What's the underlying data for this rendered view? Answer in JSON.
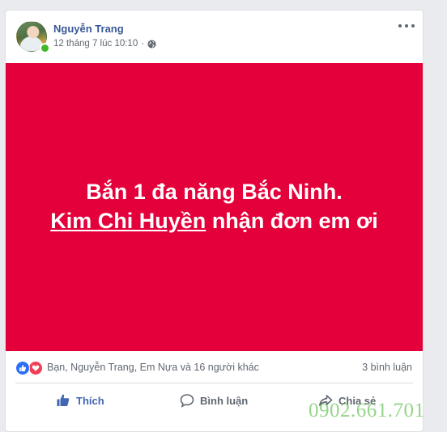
{
  "post": {
    "author": "Nguyễn Trang",
    "timestamp": "12 tháng 7 lúc 10:10",
    "separator": "·",
    "privacy_icon": "globe-icon",
    "text_line1": "Bắn 1 đa năng Bắc Ninh.",
    "mention": "Kim Chi Huyền",
    "text_line2_rest": " nhận đơn em ơi",
    "background_color": "#e4003a"
  },
  "reactions": {
    "icons": [
      "like-icon",
      "love-icon"
    ],
    "summary": "Bạn, Nguyễn Trang, Em Nựa và 16 người khác",
    "comments": "3 bình luận"
  },
  "actions": {
    "like": "Thích",
    "comment": "Bình luận",
    "share": "Chia sẻ"
  },
  "watermark": "0902.661.701"
}
